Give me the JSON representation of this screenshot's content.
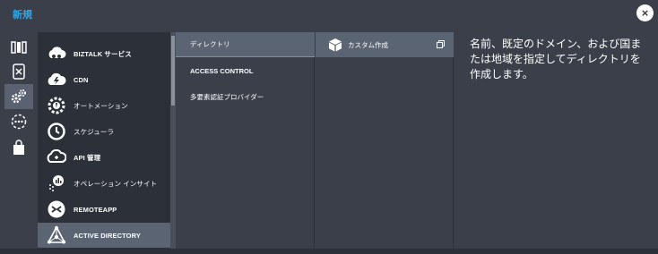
{
  "header": {
    "title": "新規",
    "close_glyph": "×"
  },
  "rail": {
    "items": [
      {
        "icon": "compute-icon"
      },
      {
        "icon": "data-services-icon"
      },
      {
        "icon": "app-services-icon",
        "active": true
      },
      {
        "icon": "network-icon"
      },
      {
        "icon": "store-icon"
      }
    ]
  },
  "services": {
    "items": [
      {
        "label": "BIZTALK サービス",
        "icon": "biztalk-icon"
      },
      {
        "label": "CDN",
        "icon": "cdn-icon"
      },
      {
        "label": "オートメーション",
        "icon": "automation-icon"
      },
      {
        "label": "スケジューラ",
        "icon": "scheduler-icon"
      },
      {
        "label": "API 管理",
        "icon": "api-management-icon"
      },
      {
        "label": "オペレーション インサイト",
        "icon": "operational-insights-icon"
      },
      {
        "label": "REMOTEAPP",
        "icon": "remoteapp-icon"
      },
      {
        "label": "ACTIVE DIRECTORY",
        "icon": "active-directory-icon",
        "selected": true
      }
    ]
  },
  "ad_options": {
    "items": [
      {
        "label": "ディレクトリ",
        "selected": true
      },
      {
        "label": "ACCESS CONTROL"
      },
      {
        "label": "多要素認証プロバイダー"
      }
    ]
  },
  "create_options": {
    "items": [
      {
        "label": "カスタム作成",
        "icon": "cube-icon"
      }
    ]
  },
  "description": "名前、既定のドメイン、および国または地域を指定してディレクトリを作成します。",
  "colors": {
    "accent": "#2fa9e8",
    "selected": "#5b6472",
    "background": "#3a3f49",
    "column_dark": "#2c3038"
  }
}
